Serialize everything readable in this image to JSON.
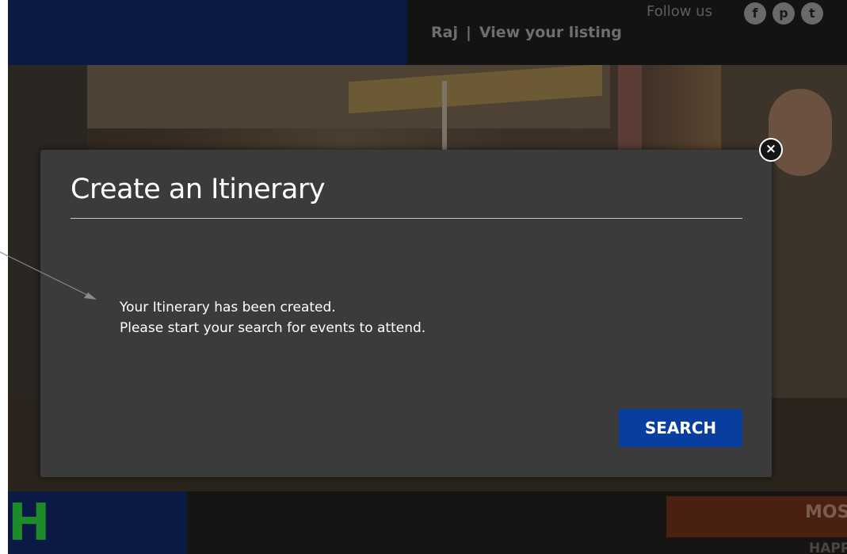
{
  "header": {
    "user_name": "Raj",
    "separator": "|",
    "view_listing_label": "View your listing",
    "follow_label": "Follow us",
    "social": [
      {
        "icon": "facebook-icon",
        "glyph": "f"
      },
      {
        "icon": "pinterest-icon",
        "glyph": "p"
      },
      {
        "icon": "twitter-icon",
        "glyph": "t"
      }
    ]
  },
  "modal": {
    "title": "Create an Itinerary",
    "message_line1": "Your Itinerary has been created.",
    "message_line2": "Please start your search for events to attend.",
    "search_label": "SEARCH",
    "close_glyph": "×"
  },
  "footer": {
    "logo_letter": "H",
    "promo_text": "MOS",
    "promo_subtext": "HAPP"
  },
  "colors": {
    "modal_bg": "#3b3b3b",
    "button_bg": "#0a3da0",
    "brand_blue": "#0a1a44",
    "accent_green": "#1e8b2a"
  }
}
